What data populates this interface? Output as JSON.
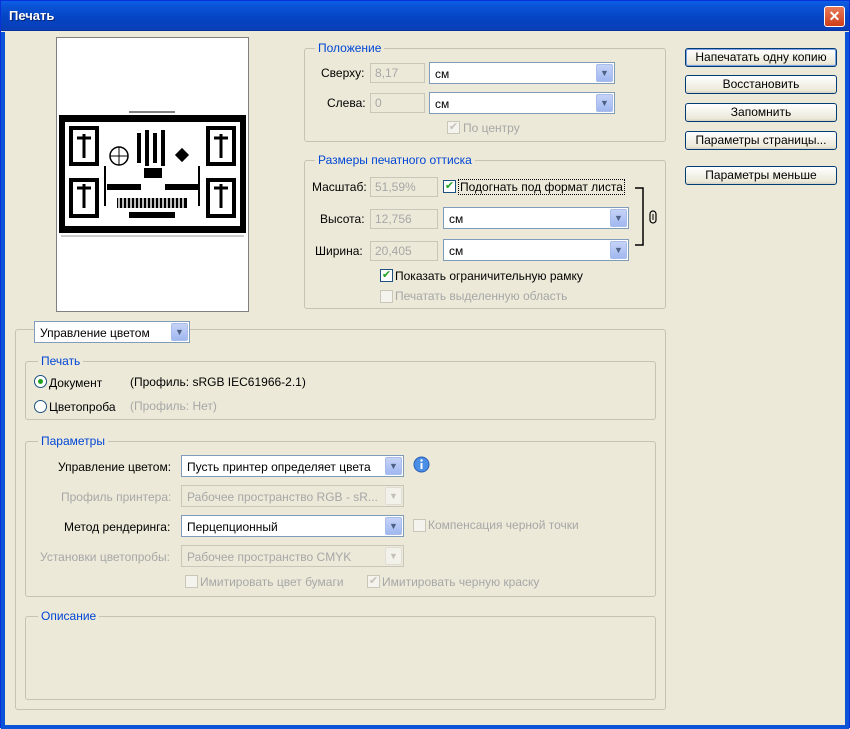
{
  "window": {
    "title": "Печать",
    "close_glyph": "✕"
  },
  "position": {
    "legend": "Положение",
    "top_label": "Сверху:",
    "top_value": "8,17",
    "top_unit": "см",
    "left_label": "Слева:",
    "left_value": "0",
    "left_unit": "см",
    "center_label": "По центру"
  },
  "print_size": {
    "legend": "Размеры печатного оттиска",
    "scale_label": "Масштаб:",
    "scale_value": "51,59%",
    "fit_label": "Подогнать под формат листа",
    "height_label": "Высота:",
    "height_value": "12,756",
    "height_unit": "см",
    "width_label": "Ширина:",
    "width_value": "20,405",
    "width_unit": "см",
    "bbox_label": "Показать ограничительную рамку",
    "print_selected_label": "Печатать выделенную область"
  },
  "buttons": {
    "print_one": "Напечатать одну копию",
    "restore": "Восстановить",
    "remember": "Запомнить",
    "page_setup": "Параметры страницы...",
    "fewer_options": "Параметры меньше"
  },
  "section_select": {
    "value": "Управление цветом"
  },
  "print_group": {
    "legend": "Печать",
    "document_label": "Документ",
    "document_profile": "(Профиль: sRGB IEC61966-2.1)",
    "proof_label": "Цветопроба",
    "proof_profile": "(Профиль: Нет)"
  },
  "params": {
    "legend": "Параметры",
    "color_mgmt_label": "Управление цветом:",
    "color_mgmt_value": "Пусть принтер определяет цвета",
    "printer_profile_label": "Профиль принтера:",
    "printer_profile_value": "Рабочее пространство RGB - sR...",
    "render_label": "Метод рендеринга:",
    "render_value": "Перцепционный",
    "black_comp_label": "Компенсация черной точки",
    "proof_setup_label": "Установки цветопробы:",
    "proof_setup_value": "Рабочее пространство CMYK",
    "paper_color_label": "Имитировать цвет бумаги",
    "black_ink_label": "Имитировать черную краску"
  },
  "description": {
    "legend": "Описание"
  },
  "icons": {
    "info": "info-icon",
    "link": "chain-link-icon",
    "dropdown": "▼"
  }
}
